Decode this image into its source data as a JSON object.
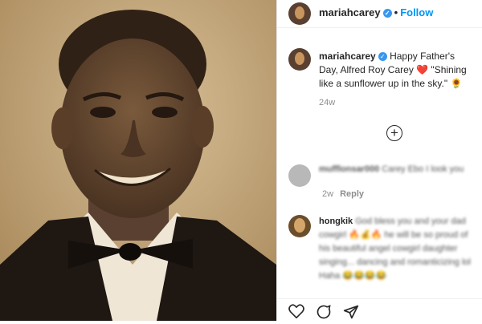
{
  "post": {
    "username": "mariahcarey",
    "follow_label": "Follow",
    "separator": "•",
    "caption": {
      "username": "mariahcarey",
      "text": "Happy Father's Day, Alfred Roy Carey ❤️ \"Shining like a sunflower up in the sky.\" 🌻"
    },
    "caption_time": "24w",
    "load_more_icon": "plus-circle-icon"
  },
  "comments": [
    {
      "username": "mufflonsar000",
      "text": "Carey Ebo I look you",
      "time": "2w",
      "reply_label": "Reply"
    },
    {
      "username": "hongkik",
      "text": "God bless you and your dad cowgirl 🔥💰🔥 he will be so proud of his beautiful angel cowgirl daughter singing... dancing and romanticizing lol Haha 😂😂😂😂"
    }
  ],
  "icons": {
    "like": "heart-icon",
    "comment": "comment-icon",
    "share": "share-icon",
    "verified": "verified-badge-icon"
  },
  "colors": {
    "accent": "#0095f6",
    "verified": "#3897f0",
    "photo_sepia": "#b89a6e"
  }
}
